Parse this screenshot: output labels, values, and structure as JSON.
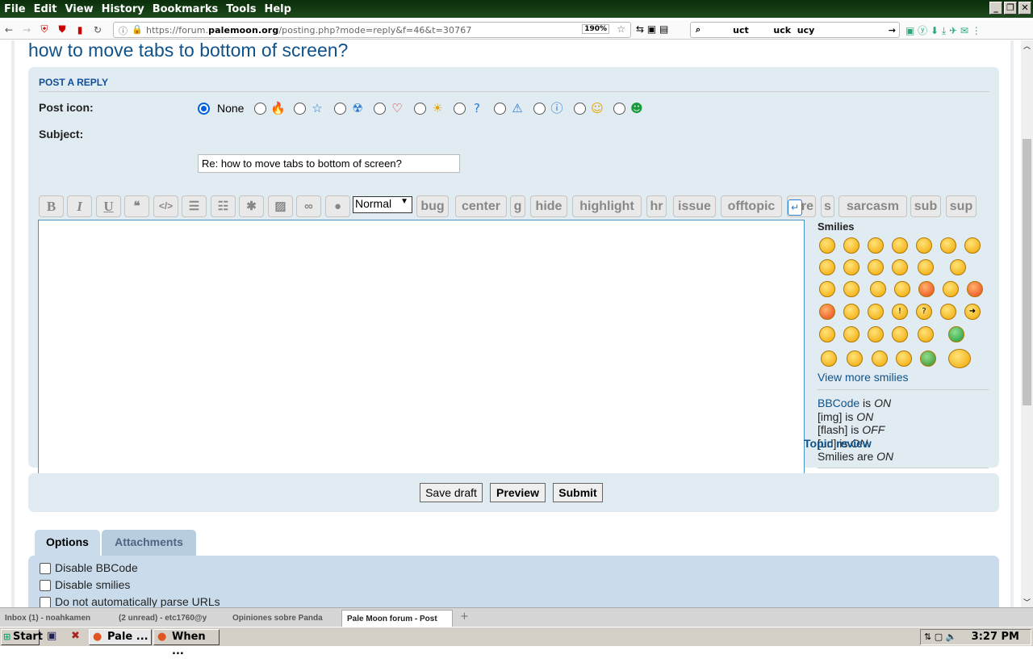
{
  "menu": [
    "File",
    "Edit",
    "View",
    "History",
    "Bookmarks",
    "Tools",
    "Help"
  ],
  "nav": {
    "url_prefix": "https://forum.",
    "url_domain": "palemoon.org",
    "url_path": "/posting.php?mode=reply&f=46&t=30767",
    "zoom": "190%",
    "search_text": "uct        uck  ucy"
  },
  "page": {
    "title": "how to move tabs to bottom of screen?",
    "post_reply": "POST A REPLY",
    "post_icon_label": "Post icon:",
    "none_label": "None",
    "subject_label": "Subject:",
    "subject_value": "Re: how to move tabs to bottom of screen?",
    "size_select": "Normal",
    "bbcode_buttons": [
      "bug",
      "center",
      "g",
      "hide",
      "highlight",
      "hr",
      "issue",
      "offtopic",
      "re",
      "s",
      "sarcasm",
      "sub",
      "sup"
    ],
    "smilies_title": "Smilies",
    "view_more": "View more smilies",
    "status": {
      "bbcode_link": "BBCode",
      "bbcode_is": "is",
      "bbcode_val": "ON",
      "img": "[img] is",
      "img_val": "ON",
      "flash": "[flash] is",
      "flash_val": "OFF",
      "url": "[url] is",
      "url_val": "ON",
      "smilies": "Smilies are",
      "smilies_val": "ON"
    },
    "topic_review": "Topic review",
    "buttons": {
      "save_draft": "Save draft",
      "preview": "Preview",
      "submit": "Submit"
    },
    "tabs": {
      "options": "Options",
      "attachments": "Attachments"
    },
    "options": [
      "Disable BBCode",
      "Disable smilies",
      "Do not automatically parse URLs"
    ]
  },
  "browser_tabs": [
    {
      "label": "Inbox (1) - noahkamen"
    },
    {
      "label": "(2 unread) - etc1760@y"
    },
    {
      "label": "Opiniones sobre Panda"
    },
    {
      "label": "Pale Moon forum - Post"
    }
  ],
  "taskbar": {
    "start": "Start",
    "task1": "Pale ...",
    "task2": "When ...",
    "time": "3:27 PM"
  }
}
